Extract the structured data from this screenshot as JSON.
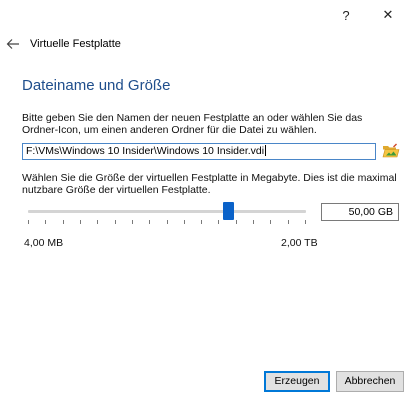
{
  "titlebar": {
    "help_label": "?",
    "close_label": "✕"
  },
  "wizard": {
    "back_icon": "arrow-left-icon",
    "title": "Virtuelle Festplatte"
  },
  "page": {
    "heading": "Dateiname und Größe",
    "location_text": "Bitte geben Sie den Namen der neuen Festplatte an oder wählen Sie das Ordner-Icon, um einen anderen Ordner für die Datei zu wählen.",
    "location_value": "F:\\VMs\\Windows 10 Insider\\Windows 10 Insider.vdi",
    "folder_icon": "folder-open-icon",
    "size_text": "Wählen Sie die Größe der virtuellen Festplatte in Megabyte. Dies ist die maximal nutzbare Größe der virtuellen Festplatte.",
    "size_value": "50,00 GB",
    "slider_fraction": 0.72,
    "range_min": "4,00 MB",
    "range_max": "2,00 TB"
  },
  "buttons": {
    "create": "Erzeugen",
    "cancel": "Abbrechen"
  },
  "colors": {
    "heading": "#1f4e8c",
    "accent": "#0a62c9"
  }
}
